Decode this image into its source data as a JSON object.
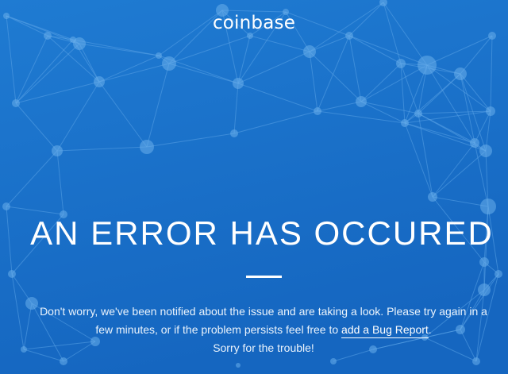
{
  "brand": {
    "logo_text": "coinbase"
  },
  "error": {
    "title": "AN ERROR HAS OCCURED",
    "message_before_link": "Don't worry, we've been notified about the issue and are taking a look. Please try again in a few minutes, or if the problem persists feel free to ",
    "link_label": "add a Bug Report",
    "message_after_link": ".",
    "closing": "Sorry for the trouble!"
  },
  "colors": {
    "background": "#1a6fc8",
    "network_lines": "#5aa3e6",
    "network_nodes": "#62a9ea",
    "text": "#ffffff"
  }
}
